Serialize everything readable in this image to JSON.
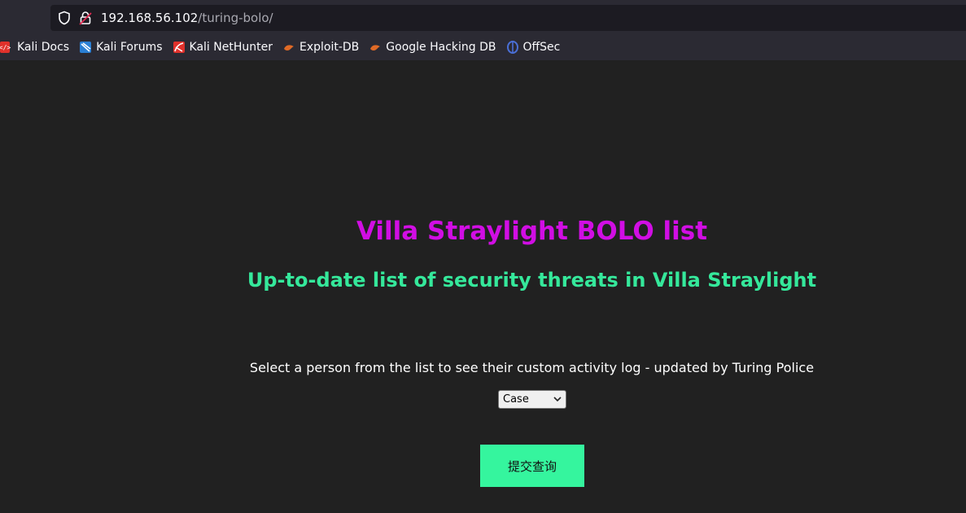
{
  "browser": {
    "url_host": "192.168.56.102",
    "url_path": "/turing-bolo/",
    "bookmarks": [
      {
        "label": "Kali Docs",
        "icon": "kali-docs-icon",
        "color": "#e0312b"
      },
      {
        "label": "Kali Forums",
        "icon": "kali-forums-icon",
        "color": "#2a7fd4"
      },
      {
        "label": "Kali NetHunter",
        "icon": "kali-nethunter-icon",
        "color": "#e0312b"
      },
      {
        "label": "Exploit-DB",
        "icon": "exploit-db-icon",
        "color": "#e06a26"
      },
      {
        "label": "Google Hacking DB",
        "icon": "google-hacking-db-icon",
        "color": "#e06a26"
      },
      {
        "label": "OffSec",
        "icon": "offsec-icon",
        "color": "#4a6fd6"
      }
    ]
  },
  "page": {
    "title": "Villa Straylight BOLO list",
    "subtitle": "Up-to-date list of security threats in Villa Straylight",
    "instruction": "Select a person from the list to see their custom activity log - updated by Turing Police",
    "select_value": "Case",
    "submit_label": "提交查询"
  },
  "colors": {
    "title": "#d10ee4",
    "subtitle": "#35e89b",
    "submit_bg": "#35f59e",
    "background": "#212121"
  }
}
